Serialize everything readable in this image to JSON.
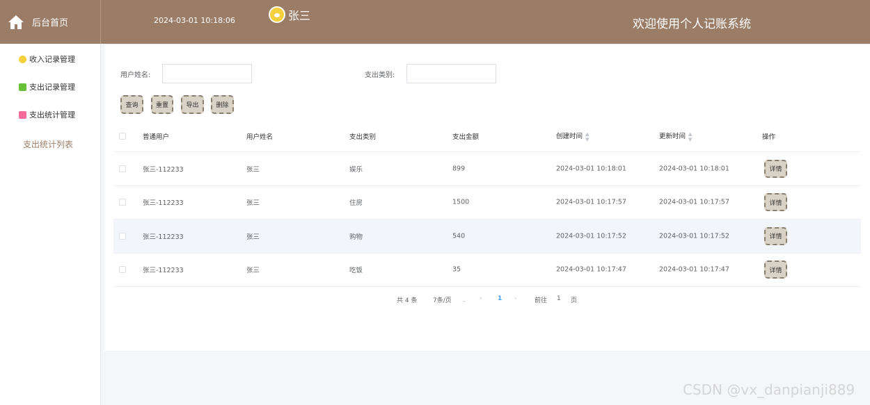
{
  "header": {
    "home_label": "后台首页",
    "datetime": "2024-03-01 10:18:06",
    "user_name": "张三",
    "welcome": "欢迎使用个人记账系统"
  },
  "sidebar": {
    "items": [
      {
        "label": "收入记录管理",
        "color": "#f6cf3c"
      },
      {
        "label": "支出记录管理",
        "color": "#67c23a"
      },
      {
        "label": "支出统计管理",
        "color": "#f56c9a"
      }
    ],
    "sub_item": "支出统计列表"
  },
  "filters": {
    "user_name_label": "用户姓名:",
    "user_name_value": "",
    "category_label": "支出类别:",
    "category_value": ""
  },
  "actions": {
    "query": "查询",
    "reset": "重置",
    "export": "导出",
    "delete": "删除"
  },
  "table": {
    "columns": [
      "普通用户",
      "用户姓名",
      "支出类别",
      "支出金额",
      "创建时间",
      "更新时间",
      "操作"
    ],
    "rows": [
      {
        "user": "张三-112233",
        "name": "张三",
        "category": "娱乐",
        "amount": "899",
        "created": "2024-03-01 10:18:01",
        "updated": "2024-03-01 10:18:01",
        "action": "详情"
      },
      {
        "user": "张三-112233",
        "name": "张三",
        "category": "住房",
        "amount": "1500",
        "created": "2024-03-01 10:17:57",
        "updated": "2024-03-01 10:17:57",
        "action": "详情"
      },
      {
        "user": "张三-112233",
        "name": "张三",
        "category": "购物",
        "amount": "540",
        "created": "2024-03-01 10:17:52",
        "updated": "2024-03-01 10:17:52",
        "action": "详情"
      },
      {
        "user": "张三-112233",
        "name": "张三",
        "category": "吃饭",
        "amount": "35",
        "created": "2024-03-01 10:17:47",
        "updated": "2024-03-01 10:17:47",
        "action": "详情"
      }
    ]
  },
  "pagination": {
    "total": "共 4 条",
    "page_size": "7条/页",
    "current_page": "1",
    "goto_label": "前往",
    "goto_value": "1",
    "page_unit": "页"
  },
  "watermark": "CSDN @vx_danpianji889"
}
